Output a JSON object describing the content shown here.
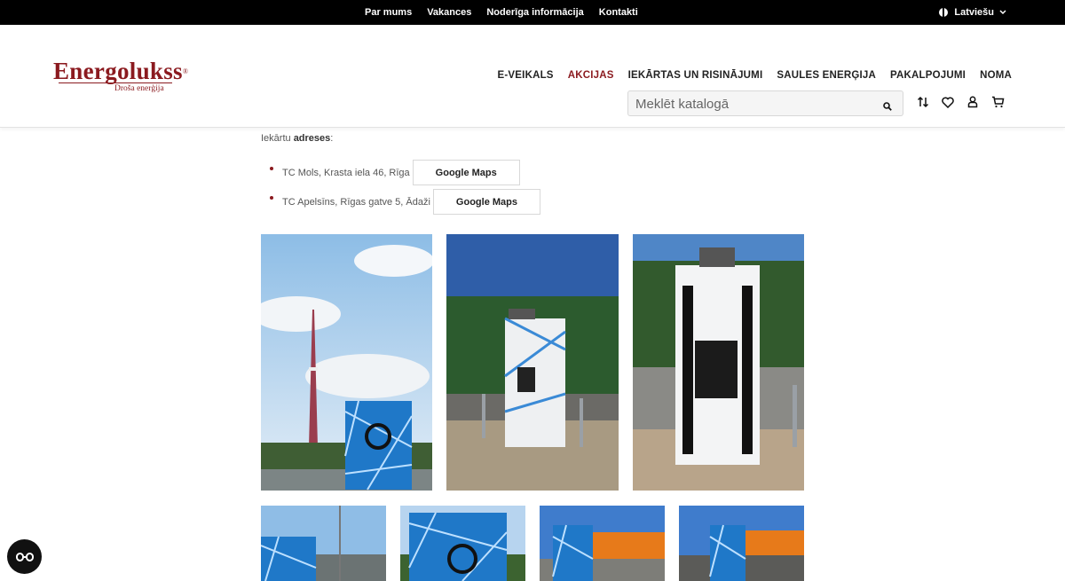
{
  "topbar": {
    "links": [
      "Par mums",
      "Vakances",
      "Noderīga informācija",
      "Kontakti"
    ],
    "language": "Latviešu"
  },
  "logo": {
    "name": "Energolukss",
    "reg": "®",
    "tagline": "Droša enerģija"
  },
  "nav": {
    "items": [
      "E-VEIKALS",
      "AKCIJAS",
      "IEKĀRTAS UN RISINĀJUMI",
      "SAULES ENERĢIJA",
      "PAKALPOJUMI",
      "NOMA"
    ],
    "active": "AKCIJAS"
  },
  "search": {
    "placeholder": "Meklēt katalogā",
    "value": ""
  },
  "header_icons": [
    "compare-icon",
    "heart-icon",
    "user-icon",
    "cart-icon"
  ],
  "content": {
    "intro_prefix": "Iekārtu ",
    "intro_bold": "adreses",
    "intro_suffix": ":",
    "addresses": [
      {
        "text": "TC Mols, Krasta iela 46, Rīga",
        "button": "Google Maps"
      },
      {
        "text": "TC Apelsīns, Rīgas gatve 5, Ādaži",
        "button": "Google Maps"
      }
    ]
  },
  "photos": {
    "large": [
      "tv-tower-charger-photo",
      "charger-station-photo-1",
      "charger-station-photo-2"
    ],
    "thumbs": [
      "thumb-1",
      "thumb-2",
      "thumb-3",
      "thumb-4"
    ]
  },
  "colors": {
    "brand": "#8b1a1f",
    "topbar": "#000000"
  }
}
